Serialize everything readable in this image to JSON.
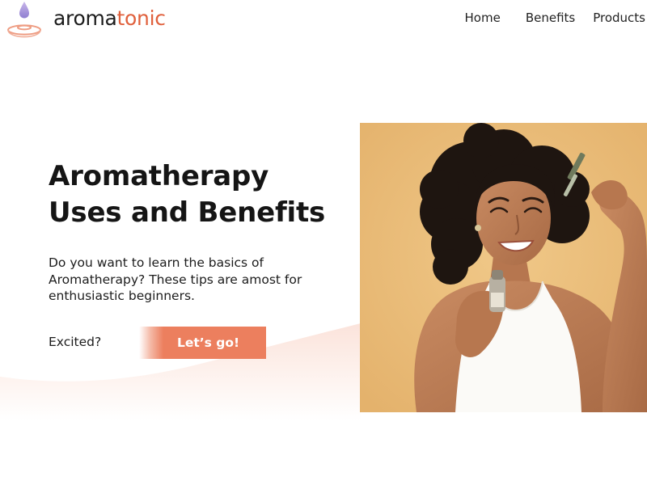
{
  "header": {
    "logo": {
      "part1": "aroma",
      "part2": "tonic"
    },
    "nav": [
      {
        "label": "Home"
      },
      {
        "label": "Benefits"
      },
      {
        "label": "Products"
      }
    ]
  },
  "hero": {
    "title_line1": "Aromatherapy",
    "title_line2": "Uses and Benefits",
    "description": "Do you want to learn the basics of Aromatherapy? These tips are amost for enthusiastic beginners.",
    "prompt": "Excited?",
    "cta_label": "Let’s go!"
  },
  "colors": {
    "brand_accent": "#e0603c",
    "cta": "#ec7f5e",
    "logo_drop": "#a99ad6",
    "photo_background": "#e9bc78"
  },
  "icons": {
    "logo": "essential-oil-drop-icon"
  }
}
